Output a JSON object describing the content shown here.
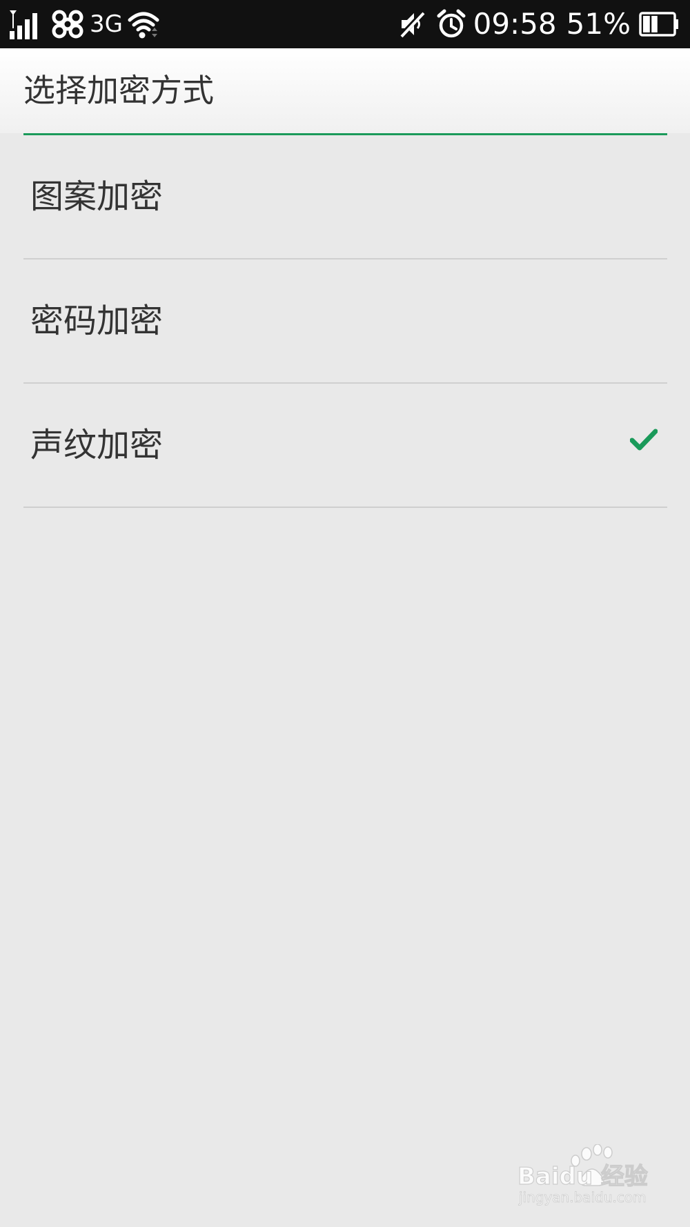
{
  "status_bar": {
    "network_type": "3G",
    "time": "09:58",
    "battery_percent": "51%",
    "battery_level": 0.51,
    "icons": [
      "signal-icon",
      "unicom-logo-icon",
      "wifi-icon",
      "mute-icon",
      "alarm-icon",
      "battery-icon"
    ]
  },
  "header": {
    "title": "选择加密方式"
  },
  "options": [
    {
      "label": "图案加密",
      "selected": false
    },
    {
      "label": "密码加密",
      "selected": false
    },
    {
      "label": "声纹加密",
      "selected": true
    }
  ],
  "watermark": {
    "logo_text": "Baidu 经验",
    "url_text": "jingyan.baidu.com"
  },
  "colors": {
    "accent": "#1a9a5a",
    "background": "#e9e9e9",
    "status_bar": "#111111",
    "text": "#333333"
  }
}
